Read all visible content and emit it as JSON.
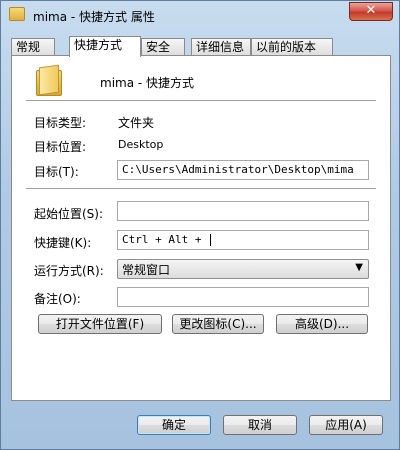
{
  "window": {
    "title": "mima - 快捷方式 属性",
    "close_label": "✕"
  },
  "tabs": [
    {
      "label": "常规"
    },
    {
      "label": "快捷方式"
    },
    {
      "label": "安全"
    },
    {
      "label": "详细信息"
    },
    {
      "label": "以前的版本"
    }
  ],
  "shortcut": {
    "name": "mima - 快捷方式",
    "target_type_label": "目标类型:",
    "target_type_value": "文件夹",
    "target_location_label": "目标位置:",
    "target_location_value": "Desktop",
    "target_label": "目标(T):",
    "target_value": "C:\\Users\\Administrator\\Desktop\\mima",
    "start_in_label": "起始位置(S):",
    "start_in_value": "",
    "hotkey_label": "快捷键(K):",
    "hotkey_value": "Ctrl + Alt + ",
    "run_label": "运行方式(R):",
    "run_value": "常规窗口",
    "comment_label": "备注(O):",
    "comment_value": ""
  },
  "buttons": {
    "open_location": "打开文件位置(F)",
    "change_icon": "更改图标(C)...",
    "advanced": "高级(D)...",
    "ok": "确定",
    "cancel": "取消",
    "apply": "应用(A)"
  }
}
